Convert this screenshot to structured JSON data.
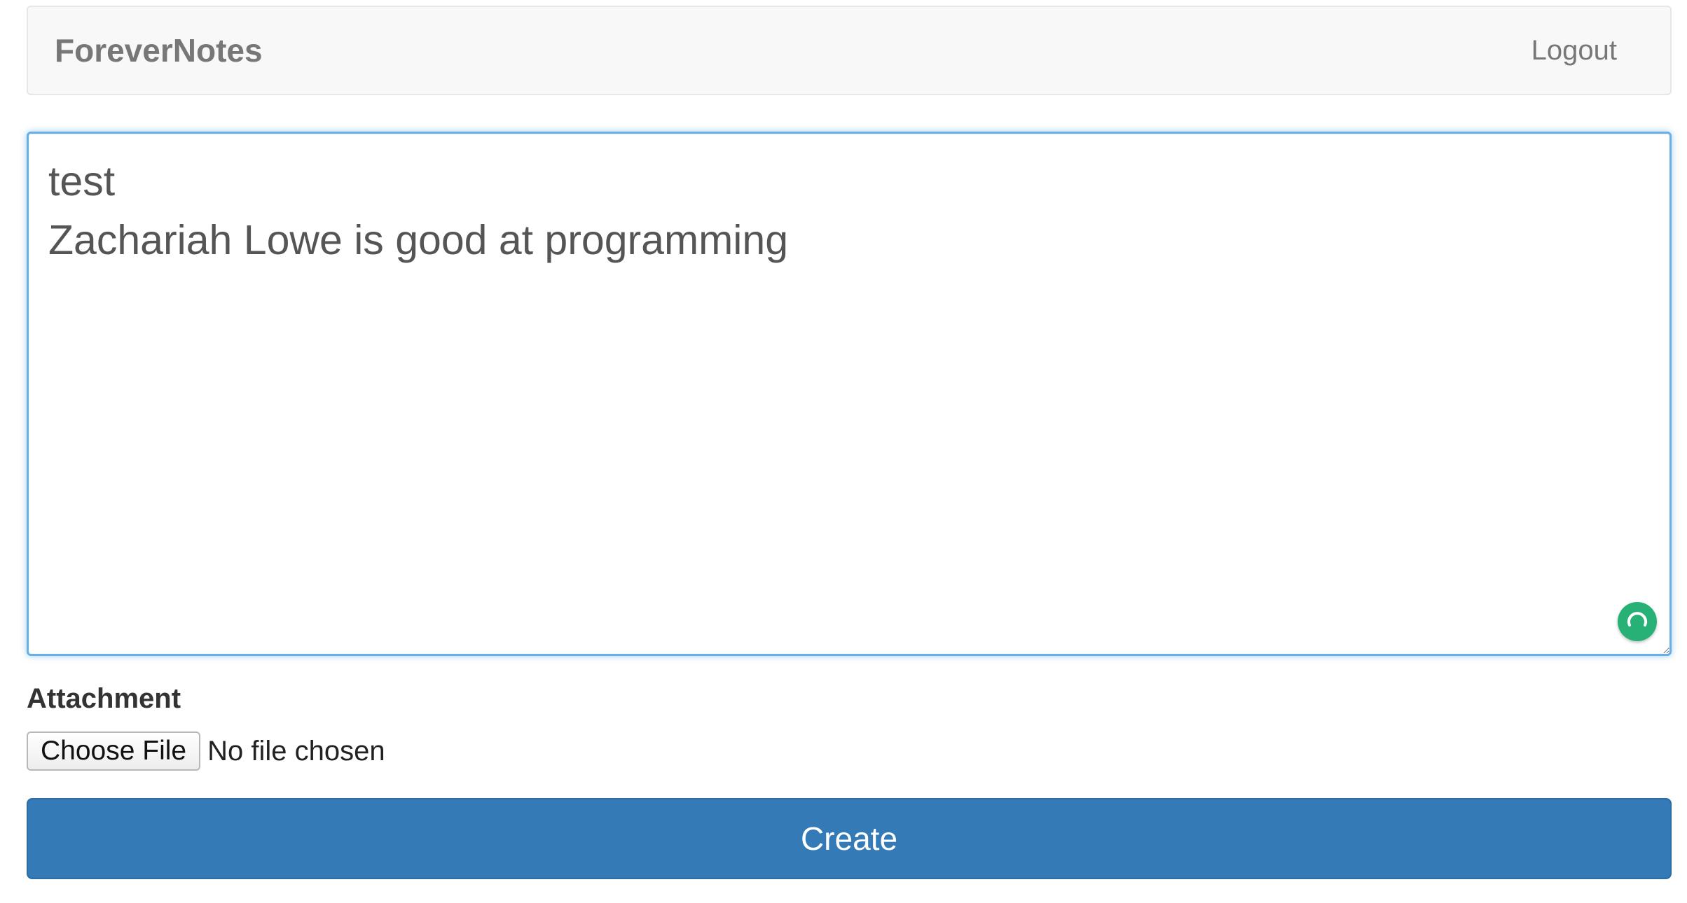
{
  "navbar": {
    "brand": "ForeverNotes",
    "logout_label": "Logout"
  },
  "editor": {
    "content": "test\nZachariah Lowe is good at programming",
    "grammar_badge_icon": "grammar-assistant-icon",
    "grammar_badge_color": "#27b176"
  },
  "attachment": {
    "label": "Attachment",
    "choose_file_label": "Choose File",
    "file_status": "No file chosen"
  },
  "actions": {
    "create_label": "Create"
  },
  "colors": {
    "primary": "#337ab7",
    "focus_border": "#66afe9",
    "navbar_bg": "#f8f8f8"
  }
}
